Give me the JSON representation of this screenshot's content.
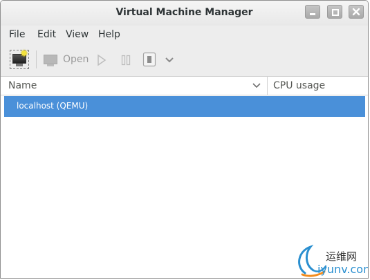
{
  "window": {
    "title": "Virtual Machine Manager"
  },
  "menubar": {
    "items": [
      {
        "label": "File"
      },
      {
        "label": "Edit"
      },
      {
        "label": "View"
      },
      {
        "label": "Help"
      }
    ]
  },
  "toolbar": {
    "new_vm_icon": "new-vm-monitor-star-icon",
    "open_label": "Open",
    "open_icon": "monitor-icon",
    "run_icon": "play-icon",
    "pause_icon": "pause-icon",
    "shutdown_icon": "shutdown-icon",
    "more_icon": "chevron-down-icon",
    "enabled": {
      "open": false,
      "run": false,
      "pause": false,
      "shutdown": false
    }
  },
  "list": {
    "columns": [
      {
        "label": "Name"
      },
      {
        "label": "CPU usage"
      }
    ],
    "rows": [
      {
        "label": "localhost (QEMU)",
        "selected": true
      }
    ]
  },
  "watermark": {
    "cn": "运维网",
    "en": "iyunv.com"
  },
  "colors": {
    "selection": "#4a90d9",
    "titlebar": "#ececec",
    "disabled_text": "#9a9a9a"
  }
}
